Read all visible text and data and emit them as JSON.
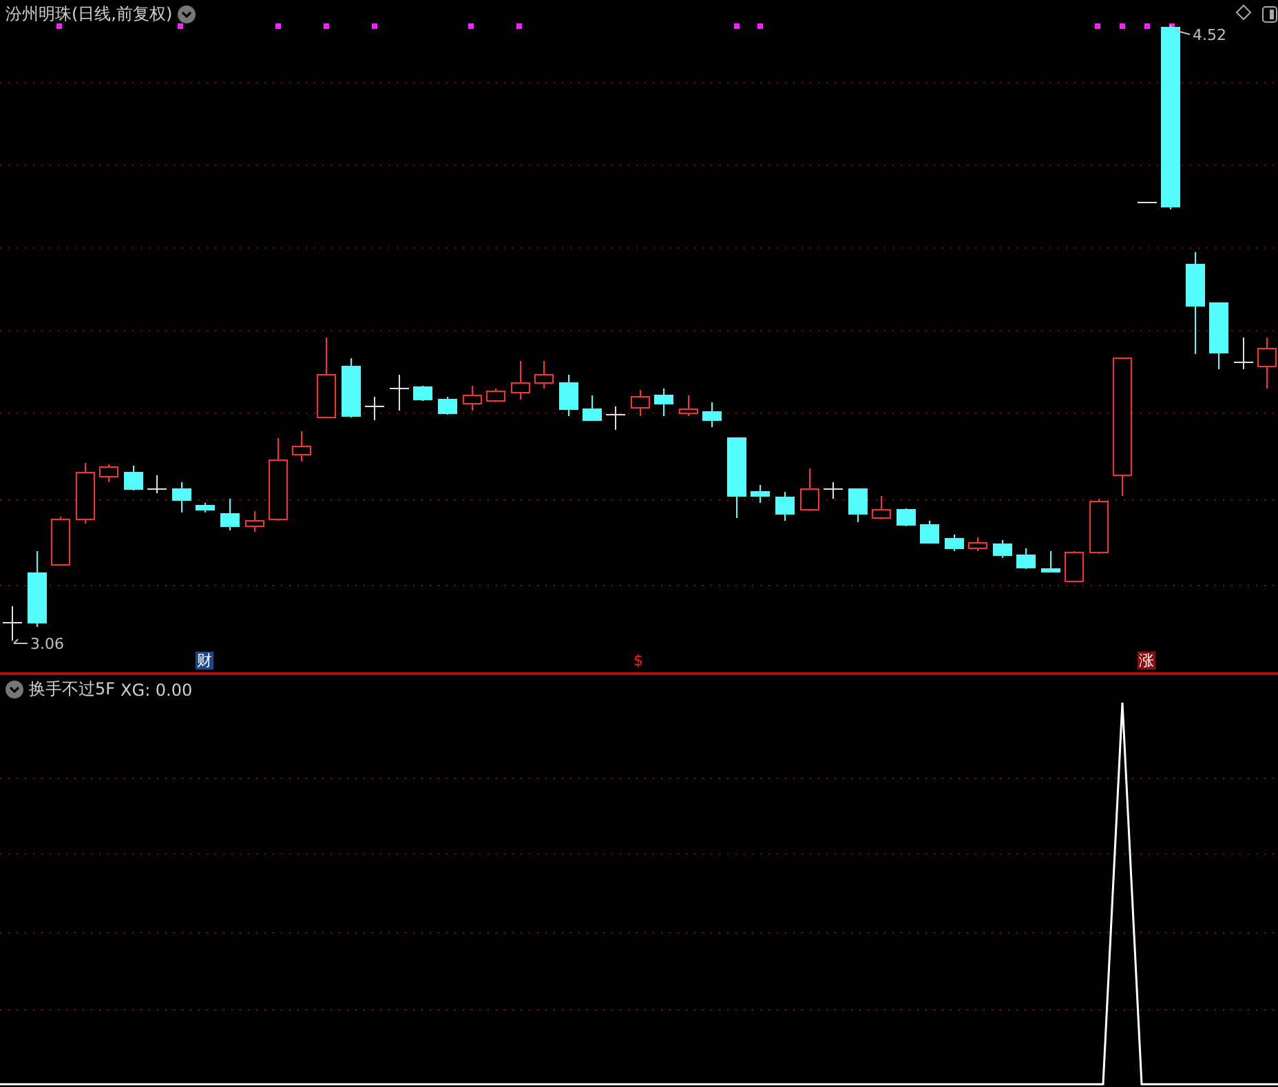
{
  "main_panel": {
    "title": "汾州明珠(日线,前复权)",
    "low_label": "3.06",
    "high_label": "4.52",
    "markers": [
      {
        "kind": "finance",
        "text": "财"
      },
      {
        "kind": "dollar",
        "text": "$"
      },
      {
        "kind": "limit_up",
        "text": "涨"
      }
    ]
  },
  "indicator_panel": {
    "title": "换手不过5F",
    "value_label": "XG: 0.00"
  }
}
